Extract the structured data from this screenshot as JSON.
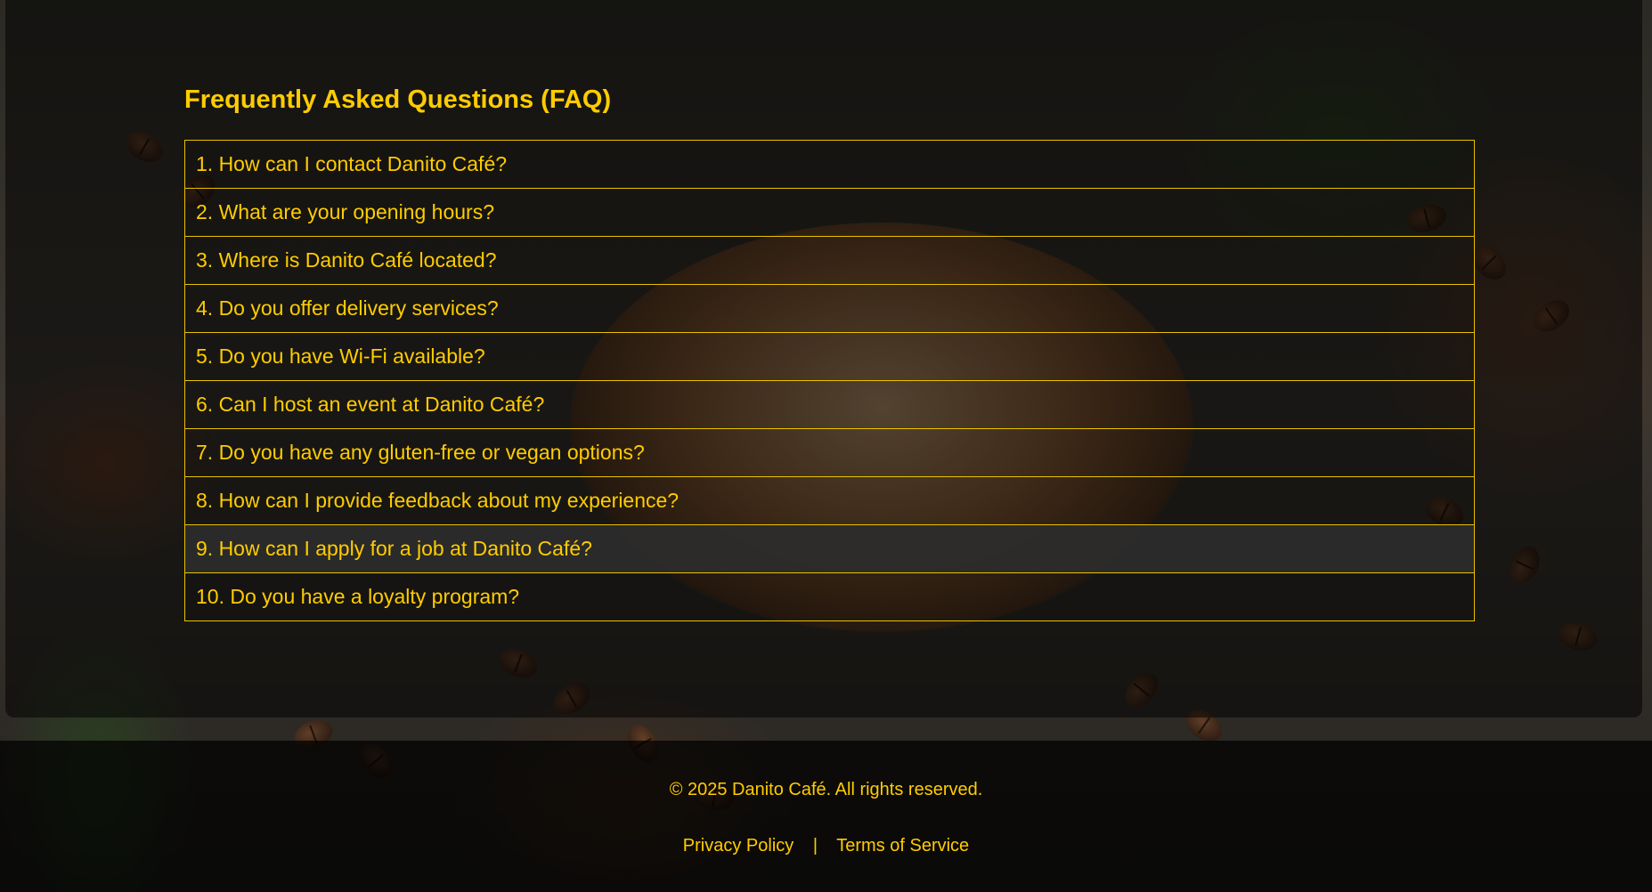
{
  "faq": {
    "title": "Frequently Asked Questions (FAQ)",
    "items": [
      "1. How can I contact Danito Café?",
      "2. What are your opening hours?",
      "3. Where is Danito Café located?",
      "4. Do you offer delivery services?",
      "5. Do you have Wi-Fi available?",
      "6. Can I host an event at Danito Café?",
      "7. Do you have any gluten-free or vegan options?",
      "8. How can I provide feedback about my experience?",
      "9. How can I apply for a job at Danito Café?",
      "10. Do you have a loyalty program?"
    ],
    "hovered_index": 8
  },
  "footer": {
    "copyright": "© 2025 Danito Café. All rights reserved.",
    "privacy_label": "Privacy Policy",
    "separator": "|",
    "terms_label": "Terms of Service"
  },
  "colors": {
    "accent": "#ffcc00",
    "border": "#e8c200",
    "hover_bg": "#2d2d2d"
  }
}
